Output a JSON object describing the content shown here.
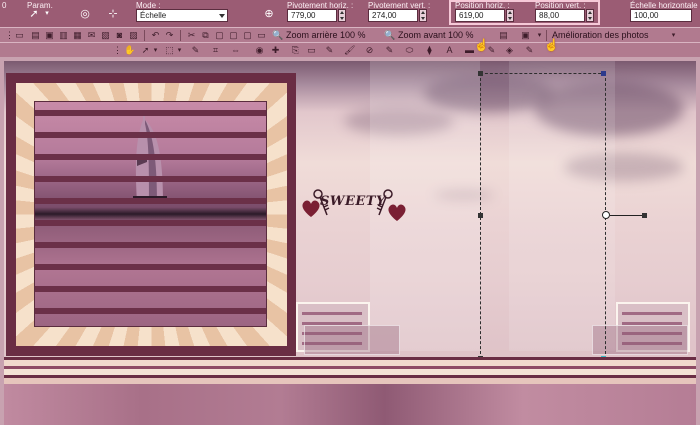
{
  "options_bar": {
    "param_label": "Param.",
    "mode_label": "Mode :",
    "mode_value": "Échelle",
    "pivot_h_label": "Pivotement horiz. :",
    "pivot_h_value": "779,00",
    "pivot_v_label": "Pivotement vert. :",
    "pivot_v_value": "274,00",
    "pos_h_label": "Position horiz. :",
    "pos_h_value": "619,00",
    "pos_v_label": "Position vert. :",
    "pos_v_value": "88,00",
    "scale_h_label": "Échelle horizontale",
    "scale_h_value": "100,00",
    "left_num": "0"
  },
  "toolbar1": {
    "zoom_out_label": "Zoom arrière 100 %",
    "zoom_in_label": "Zoom avant 100 %",
    "enhance_label": "Amélioration des photos"
  },
  "canvas": {
    "watermark_text": "SWEETY"
  },
  "colors": {
    "accent": "#9b5c74",
    "frame": "#6a2d44",
    "highlight_border": "#f6c9d8"
  }
}
